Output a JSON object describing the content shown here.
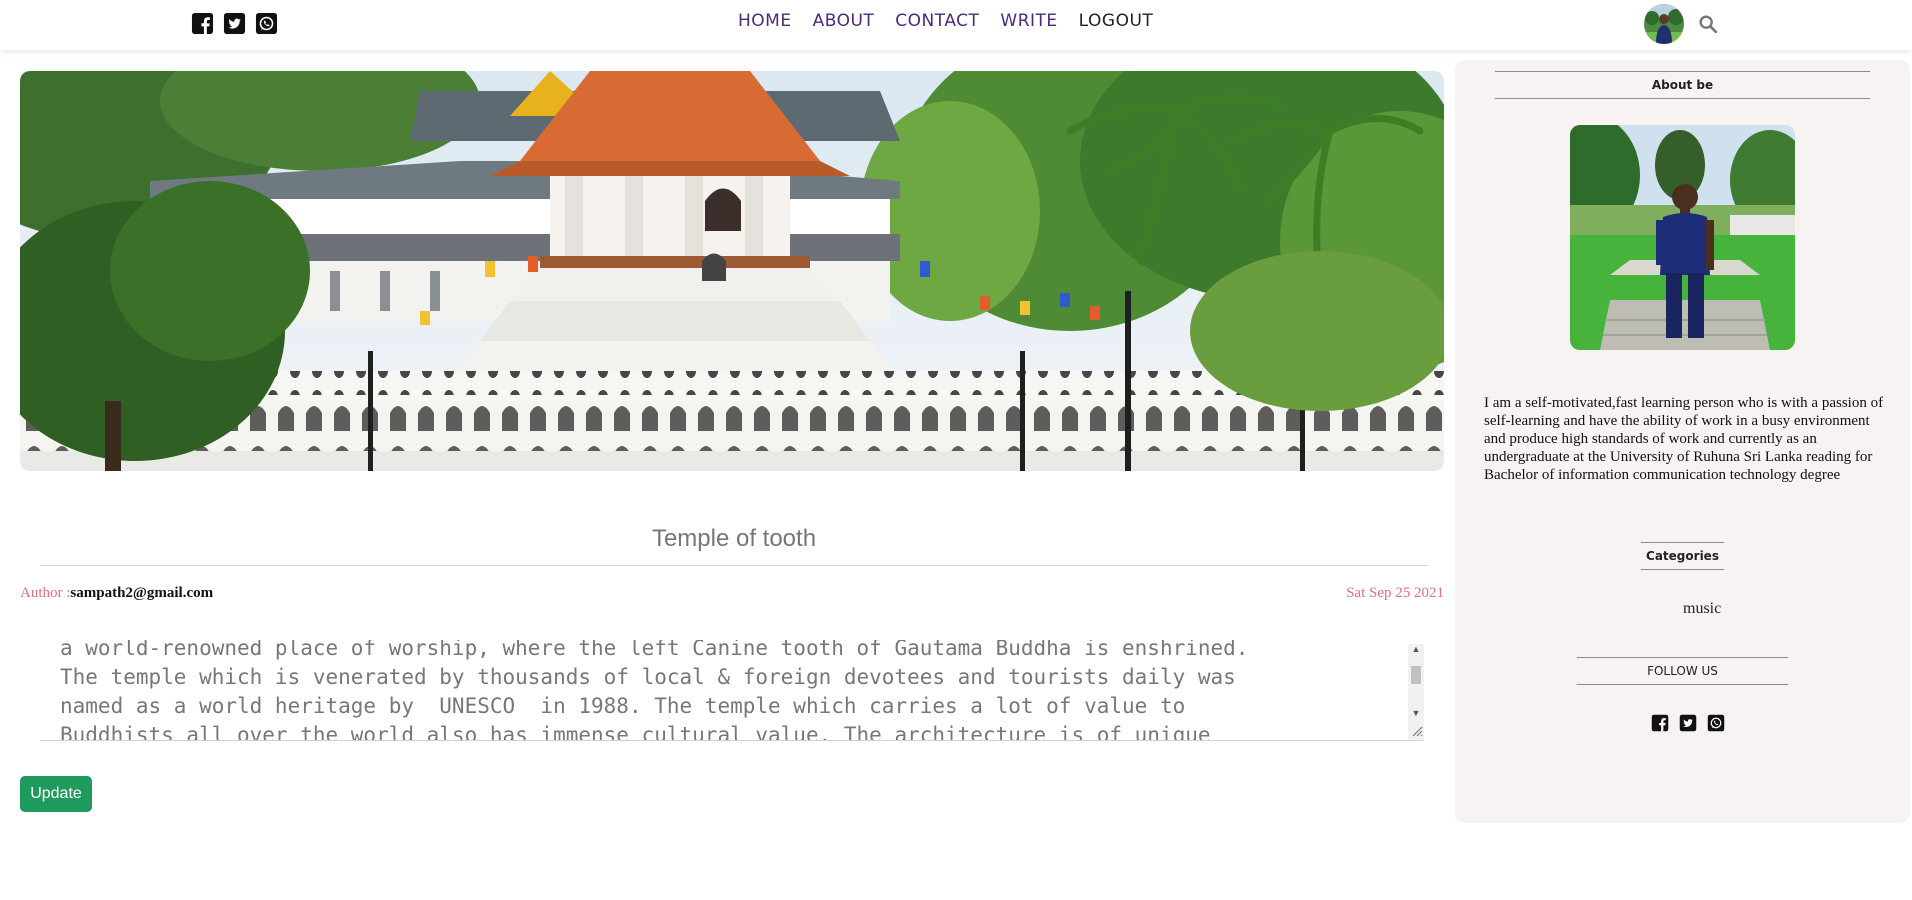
{
  "nav": {
    "items": [
      "HOME",
      "ABOUT",
      "CONTACT",
      "WRITE",
      "LOGOUT"
    ]
  },
  "icons": {
    "social": [
      "facebook-square-icon",
      "twitter-square-icon",
      "whatsapp-square-icon"
    ],
    "search": "search-icon"
  },
  "post": {
    "title": "Temple of tooth",
    "author_label": "Author :",
    "author": "sampath2@gmail.com",
    "date": "Sat Sep 25 2021",
    "description": "a world-renowned place of worship, where the left Canine tooth of Gautama Buddha is enshrined.\nThe temple which is venerated by thousands of local & foreign devotees and tourists daily was\nnamed as a world heritage by  UNESCO  in 1988. The temple which carries a lot of value to\nBuddhists all over the world also has immense cultural value. The architecture is of unique",
    "update_label": "Update"
  },
  "sidebar": {
    "about_title": "About be",
    "about_text": "I am a self-motivated,fast learning person who is with a passion of self-learning and have the ability of work in a busy environment and produce high standards of work and currently as an undergraduate at the University of Ruhuna Sri Lanka reading for Bachelor of information communication technology degree",
    "categories_title": "Categories",
    "categories": [
      "music"
    ],
    "follow_title": "FOLLOW US"
  },
  "colors": {
    "nav_link": "#4b2a7a",
    "accent_pink": "#e0707a",
    "update_button": "#1e9a5c",
    "sidebar_bg": "#f7f3f2"
  }
}
